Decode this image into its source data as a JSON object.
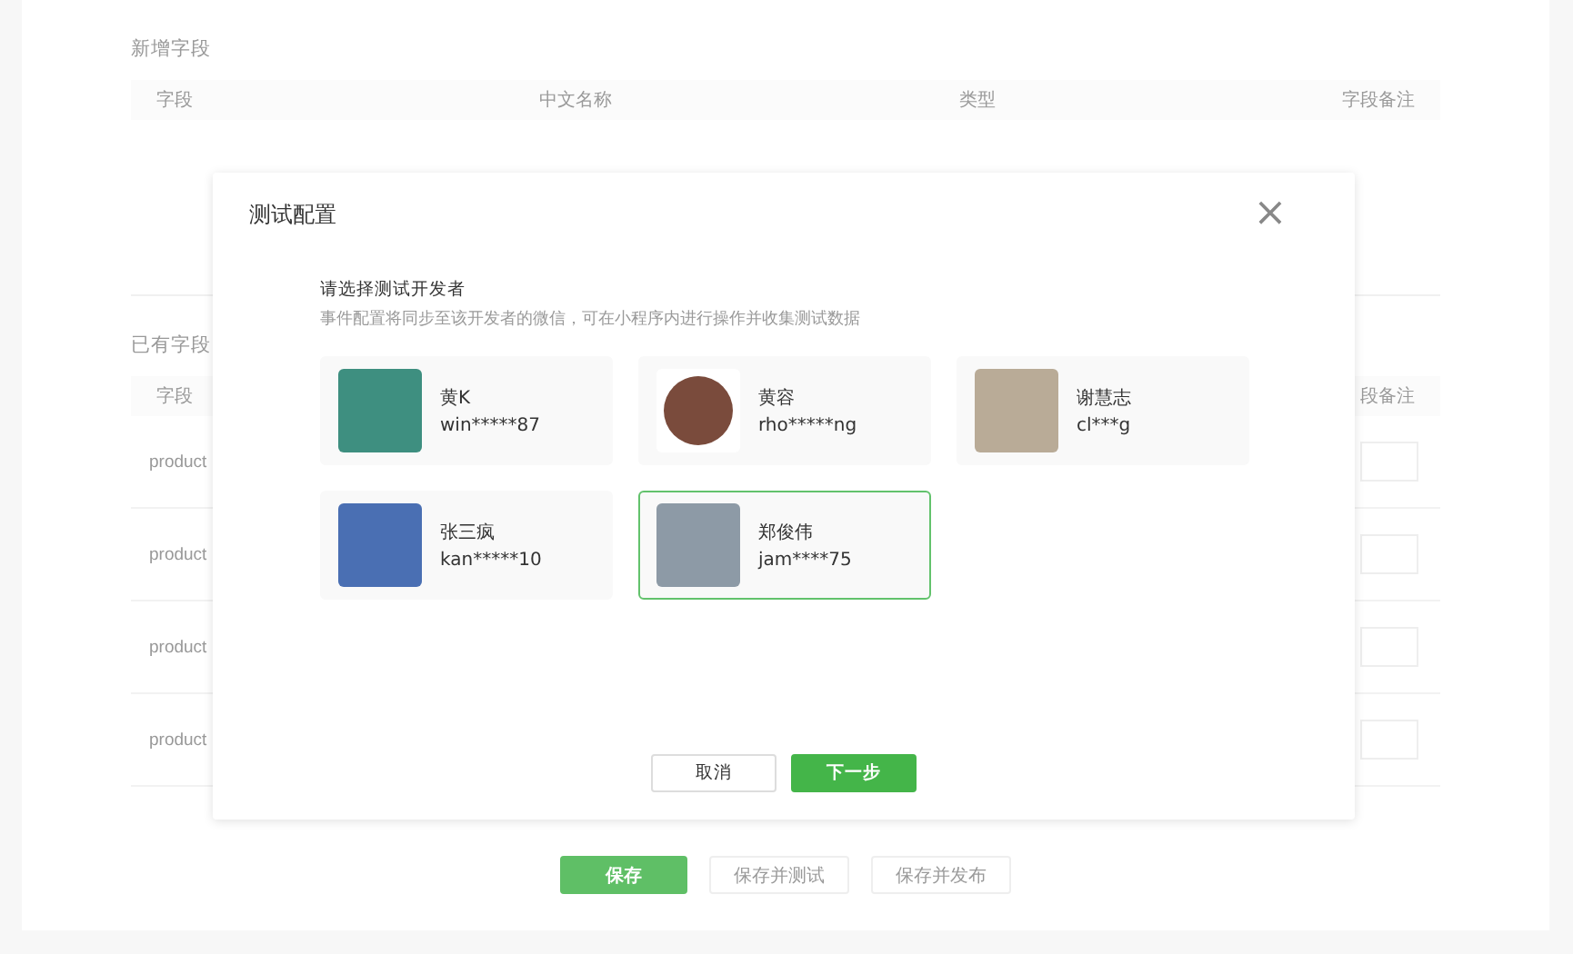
{
  "new_fields": {
    "title": "新增字段",
    "columns": [
      "字段",
      "中文名称",
      "类型",
      "字段备注"
    ]
  },
  "existing_fields": {
    "title": "已有字段",
    "columns": [
      "字段",
      "段备注"
    ],
    "rows": [
      {
        "field": "product"
      },
      {
        "field": "product"
      },
      {
        "field": "product"
      },
      {
        "field": "product"
      }
    ]
  },
  "page_buttons": [
    {
      "label": "保存",
      "kind": "primary"
    },
    {
      "label": "保存并测试",
      "kind": "default"
    },
    {
      "label": "保存并发布",
      "kind": "default"
    }
  ],
  "dialog": {
    "title": "测试配置",
    "close": "×",
    "heading": "请选择测试开发者",
    "description": "事件配置将同步至该开发者的微信，可在小程序内进行操作并收集测试数据",
    "developers": [
      {
        "name": "黄K",
        "account": "win*****87",
        "kind": "square",
        "selected": false
      },
      {
        "name": "黄容",
        "account": "rho*****ng",
        "kind": "round",
        "selected": false
      },
      {
        "name": "谢慧志",
        "account": "cl***g",
        "kind": "square",
        "selected": false
      },
      {
        "name": "张三疯",
        "account": "kan*****10",
        "kind": "square",
        "selected": false
      },
      {
        "name": "郑俊伟",
        "account": "jam****75",
        "kind": "square",
        "selected": true
      }
    ],
    "buttons": [
      {
        "label": "取消",
        "kind": "default"
      },
      {
        "label": "下一步",
        "kind": "primary"
      }
    ]
  }
}
